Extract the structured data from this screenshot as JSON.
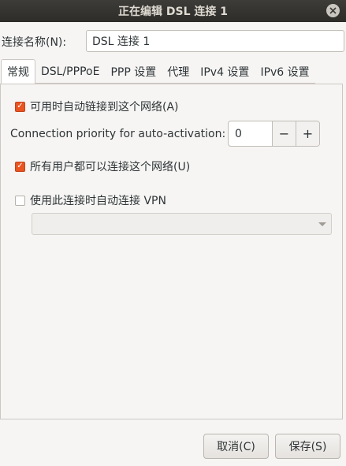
{
  "window": {
    "title": "正在编辑 DSL 连接 1",
    "close_icon": "close-icon"
  },
  "connection_name": {
    "label": "连接名称(N):",
    "value": "DSL 连接 1"
  },
  "tabs": [
    {
      "label": "常规",
      "active": true
    },
    {
      "label": "DSL/PPPoE",
      "active": false
    },
    {
      "label": "PPP 设置",
      "active": false
    },
    {
      "label": "代理",
      "active": false
    },
    {
      "label": "IPv4 设置",
      "active": false
    },
    {
      "label": "IPv6 设置",
      "active": false
    }
  ],
  "general": {
    "auto_connect": {
      "label": "可用时自动链接到这个网络(A)",
      "checked": true
    },
    "priority": {
      "label": "Connection priority for auto-activation:",
      "value": "0",
      "minus": "−",
      "plus": "+"
    },
    "all_users": {
      "label": "所有用户都可以连接这个网络(U)",
      "checked": true
    },
    "auto_vpn": {
      "label": "使用此连接时自动连接 VPN",
      "checked": false
    },
    "vpn_select": {
      "value": ""
    }
  },
  "buttons": {
    "cancel": "取消(C)",
    "save": "保存(S)"
  },
  "colors": {
    "accent": "#e95420",
    "titlebar": "#33322f"
  }
}
